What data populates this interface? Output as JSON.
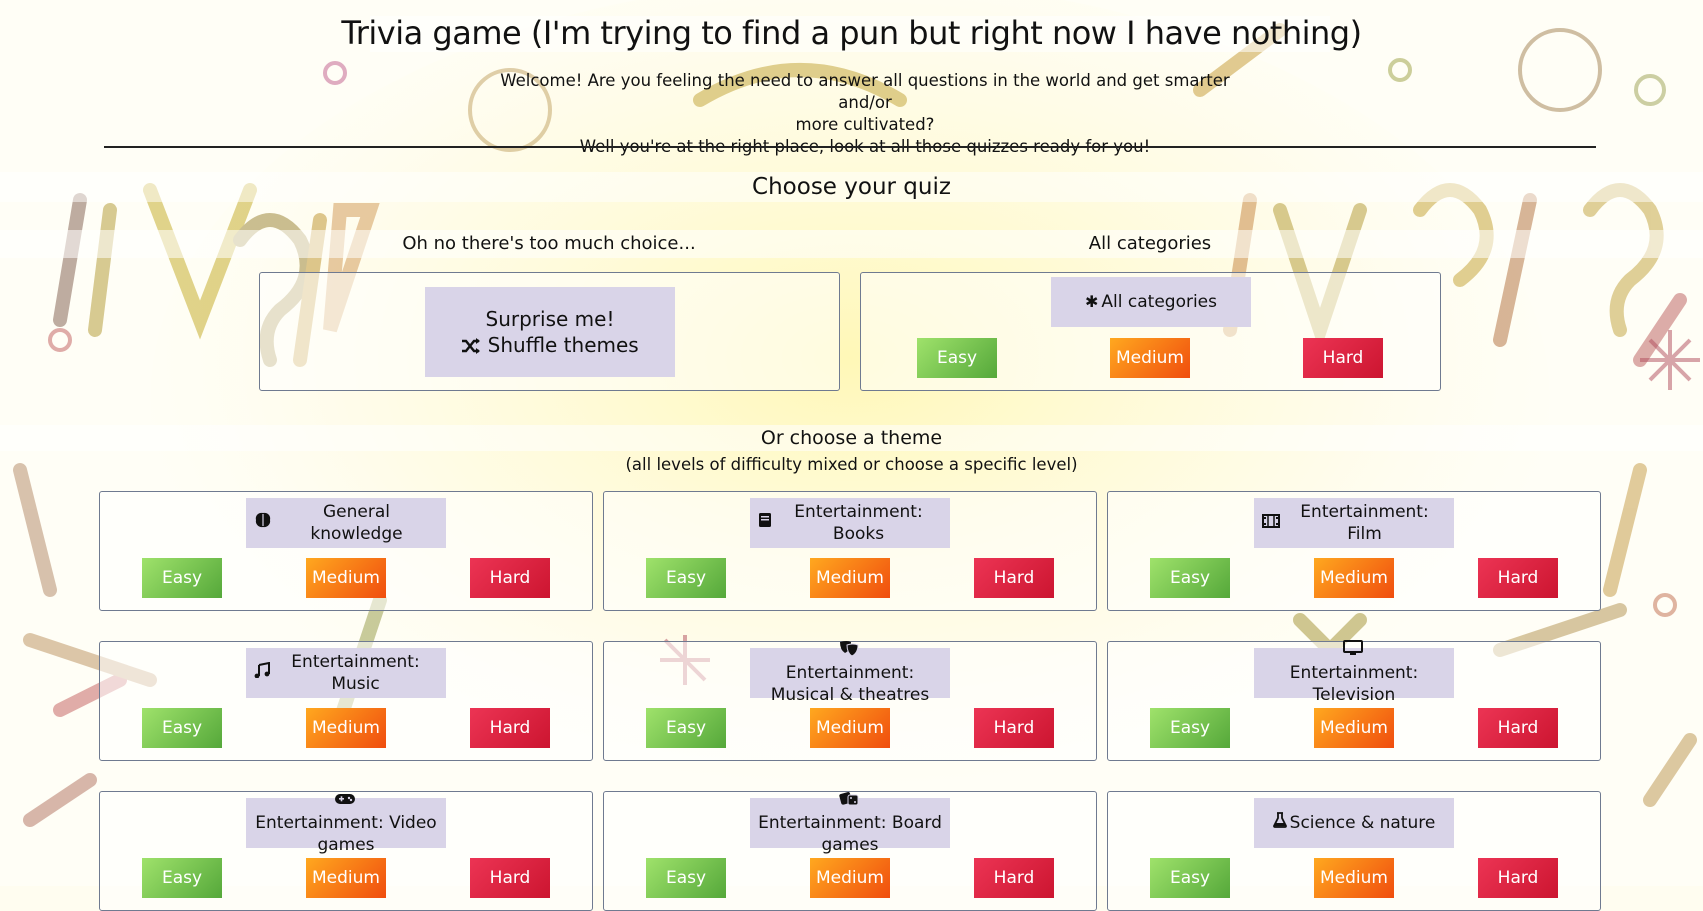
{
  "header": {
    "title": "Trivia game (I'm trying to find a pun but right now I have nothing)",
    "welcome_line1": "Welcome! Are you feeling the need to answer all questions in the world and get smarter and/or",
    "welcome_line2": "more cultivated?",
    "welcome_line3": "Well you're at the right place, look at all those quizzes ready for you!"
  },
  "choose": {
    "title": "Choose your quiz",
    "random_title": "Oh no there's too much choice...",
    "surprise_line1": "Surprise me!",
    "surprise_line2": "Shuffle themes",
    "surprise_icon": "shuffle-icon",
    "all_title": "All categories",
    "all_button": "All categories",
    "all_icon": "asterisk-icon"
  },
  "levels": {
    "easy": "Easy",
    "medium": "Medium",
    "hard": "Hard"
  },
  "colors": {
    "easy": "#6cc144",
    "medium": "#f7770f",
    "hard": "#de2140",
    "theme_button": "#d9d4e8"
  },
  "themes_section": {
    "title": "Or choose a theme",
    "note": "(all levels of difficulty mixed or choose a specific level)"
  },
  "themes": [
    {
      "label": "General knowledge",
      "icon": "brain-icon"
    },
    {
      "label": "Entertainment: Books",
      "icon": "book-icon"
    },
    {
      "label": "Entertainment: Film",
      "icon": "film-icon"
    },
    {
      "label": "Entertainment: Music",
      "icon": "music-note-icon"
    },
    {
      "label": "Entertainment: Musical & theatres",
      "icon": "theater-masks-icon"
    },
    {
      "label": "Entertainment: Television",
      "icon": "tv-icon"
    },
    {
      "label": "Entertainment: Video games",
      "icon": "gamepad-icon"
    },
    {
      "label": "Entertainment: Board games",
      "icon": "dice-icon"
    },
    {
      "label": "Science & nature",
      "icon": "flask-icon"
    }
  ]
}
